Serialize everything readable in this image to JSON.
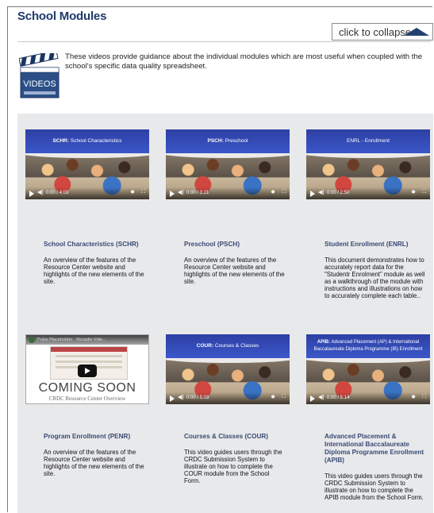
{
  "page": {
    "title": "School Modules",
    "collapse_label": "click to collapse",
    "intro": "These videos provide guidance about the individual modules which are most useful when coupled with the school's specific data quality spreadsheet.",
    "icon_label": "VIDEOS"
  },
  "colors": {
    "title": "#1d3a6b",
    "card_title": "#3b4a75",
    "panel_bg": "#e8e9eb",
    "video_banner": "#2d3fa3"
  },
  "cards": [
    {
      "banner_code": "SCHR:",
      "banner_text": "School Characteristics",
      "time": "0:00 / 4:03",
      "title": "School Characteristics (SCHR)",
      "description": "An overview of the features of the Resource Center website and highlights of the new elements of the site."
    },
    {
      "banner_code": "PSCH:",
      "banner_text": "Preschool",
      "time": "0:00 / 3:21",
      "title": "Preschool (PSCH)",
      "description": "An overview of the features of the Resource Center website and highlights of the new elements of the site."
    },
    {
      "banner_code": "ENRL",
      "banner_text": "- Enrollment",
      "time": "0:00 / 2:50",
      "title": "Student Enrollment (ENRL)",
      "description": "This document demonstrates how to accurately report data for the \"Studentr Enrolment\" module as well as a walkthrough of the module with instructions and illustrations on how to accurately complete each table.."
    },
    {
      "coming_soon": "COMING SOON",
      "yt_title": "Pulse Placeholder - Rezadie Vide...",
      "sub_caption": "CRDC Resource Center Overview",
      "title": "Program Enrollment (PENR)",
      "description": "An overview of the features of the Resource Center website and highlights of the new elements of the site."
    },
    {
      "banner_code": "COUR:",
      "banner_text": "Courses & Classes",
      "time": "0:00 / 5:03",
      "title": "Courses & Classes (COUR)",
      "description": "This video guides users through the CRDC Submission System to illustrate on how to complete the COUR module from the School Form."
    },
    {
      "banner_code": "APIB:",
      "banner_text": "Advanced Placement (AP) & International Baccalaureate Diploma Programme (IB) Enrollment",
      "time": "0:00 / 5:14",
      "title": "Advanced Placement & International Baccalaureate Diploma Programme Enrollment (APIB)",
      "description": "This video guides users through the CRDC Submission System to illustrate on how to complete the APIB module from the School Form."
    }
  ]
}
